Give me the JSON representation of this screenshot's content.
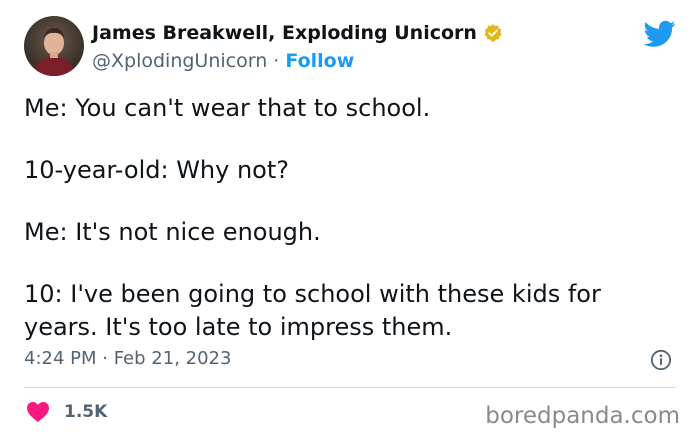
{
  "author": {
    "display_name": "James Breakwell, Exploding Unicorn",
    "handle": "@XplodingUnicorn",
    "separator": " · ",
    "follow_label": "Follow",
    "avatar_icon": "avatar-photo",
    "verified_icon": "verified-badge-icon"
  },
  "tweet": {
    "lines": [
      "Me: You can't wear that to school.",
      "10-year-old: Why not?",
      "Me: It's not nice enough.",
      "10: I've been going to school with these kids for years. It's too late to impress them."
    ],
    "timestamp": "4:24 PM · Feb 21, 2023",
    "likes": "1.5K"
  },
  "icons": {
    "logo": "twitter-bird-icon",
    "info": "info-icon",
    "like": "heart-icon"
  },
  "watermark": "boredpanda.com",
  "colors": {
    "accent": "#1d9bf0",
    "text": "#0f1419",
    "secondary": "#536471",
    "heart": "#f91880",
    "verified_gold": "#e2b719",
    "divider": "#cfd9de",
    "watermark": "#8a8a8a"
  }
}
